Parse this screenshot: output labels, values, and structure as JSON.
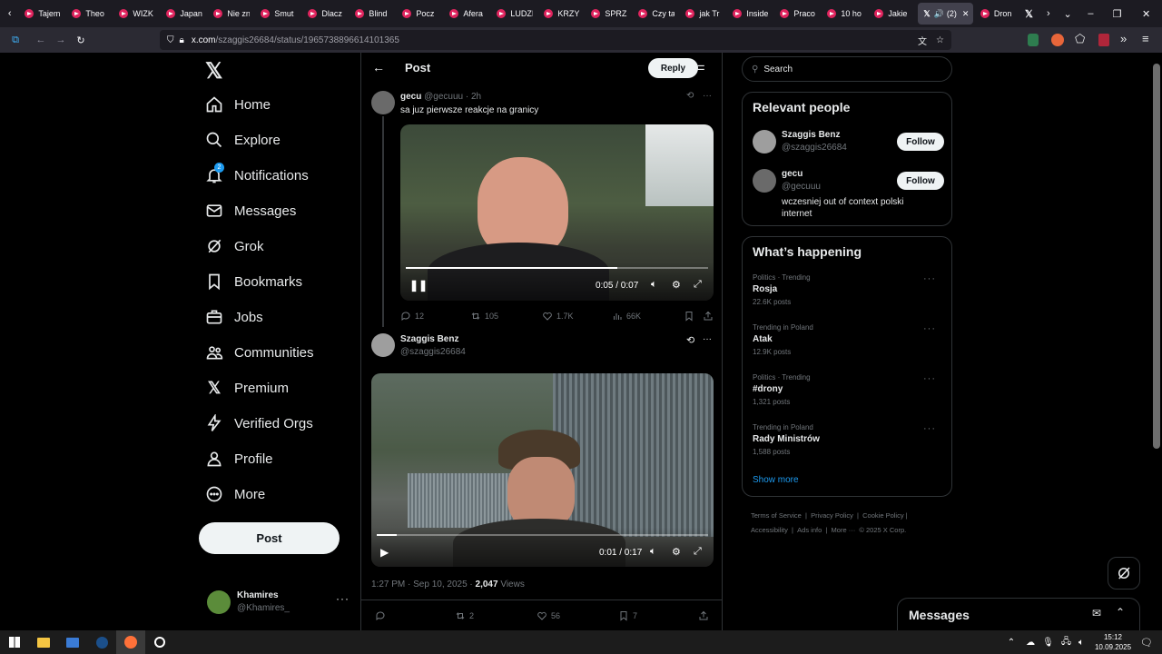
{
  "browser": {
    "tabs": [
      "Tajem",
      "Theo",
      "WIZK",
      "Japan",
      "Nie zn",
      "Smut",
      "Dlacz",
      "Blind",
      "Pocz",
      "Afera",
      "LUDZI",
      "KRZY",
      "SPRZ",
      "Czy ta",
      "jak Tr",
      "Inside",
      "Praco",
      "10 ho",
      "Jakie"
    ],
    "active_tab": "(2)",
    "after_tab": "Dron",
    "url_host": "x.com",
    "url_path": "/szaggis26684/status/1965738896614101365"
  },
  "nav": {
    "items": [
      "Home",
      "Explore",
      "Notifications",
      "Messages",
      "Grok",
      "Bookmarks",
      "Jobs",
      "Communities",
      "Premium",
      "Verified Orgs",
      "Profile",
      "More"
    ],
    "notif_badge": "2",
    "post_label": "Post",
    "account_name": "Khamires",
    "account_handle": "@Khamires_"
  },
  "header": {
    "title": "Post",
    "reply_label": "Reply"
  },
  "quoted": {
    "name": "gecu",
    "handle": "@gecuuu",
    "age": "· 2h",
    "text": "sa juz pierwsze reakcje na granicy",
    "video_time": "0:05 / 0:07",
    "video_progress": 0.7,
    "stats": {
      "replies": "12",
      "reposts": "105",
      "likes": "1.7K",
      "views": "66K"
    }
  },
  "post": {
    "name": "Szaggis Benz",
    "handle": "@szaggis26684",
    "video_time": "0:01 / 0:17",
    "video_progress": 0.06,
    "meta_time": "1:27 PM · Sep 10, 2025 · ",
    "views_count": "2,047",
    "views_label": " Views",
    "stats": {
      "reposts": "2",
      "likes": "56",
      "bookmarks": "7"
    }
  },
  "search": {
    "placeholder": "Search"
  },
  "relevant": {
    "title": "Relevant people",
    "people": [
      {
        "name": "Szaggis Benz",
        "handle": "@szaggis26684",
        "bio": ""
      },
      {
        "name": "gecu",
        "handle": "@gecuuu",
        "bio": "wczesniej out of context polski internet"
      }
    ],
    "follow_label": "Follow"
  },
  "happening": {
    "title": "What’s happening",
    "trends": [
      {
        "category": "Politics · Trending",
        "name": "Rosja",
        "count": "22.6K posts"
      },
      {
        "category": "Trending in Poland",
        "name": "Atak",
        "count": "12.9K posts"
      },
      {
        "category": "Politics · Trending",
        "name": "#drony",
        "count": "1,321 posts"
      },
      {
        "category": "Trending in Poland",
        "name": "Rady Ministrów",
        "count": "1,588 posts"
      }
    ],
    "show_more": "Show more"
  },
  "footer": {
    "links": [
      "Terms of Service",
      "|",
      "Privacy Policy",
      "|",
      "Cookie Policy",
      "|",
      "Accessibility",
      "|",
      "Ads info",
      "|",
      "More ···",
      "© 2025 X Corp."
    ]
  },
  "messages_drawer": {
    "title": "Messages"
  },
  "taskbar": {
    "time": "15:12",
    "date": "10.09.2025"
  },
  "colors": {
    "bg": "#000000",
    "border": "#2f3336",
    "muted": "#71767b",
    "text": "#e7e9ea",
    "accent": "#1d9bf0"
  }
}
